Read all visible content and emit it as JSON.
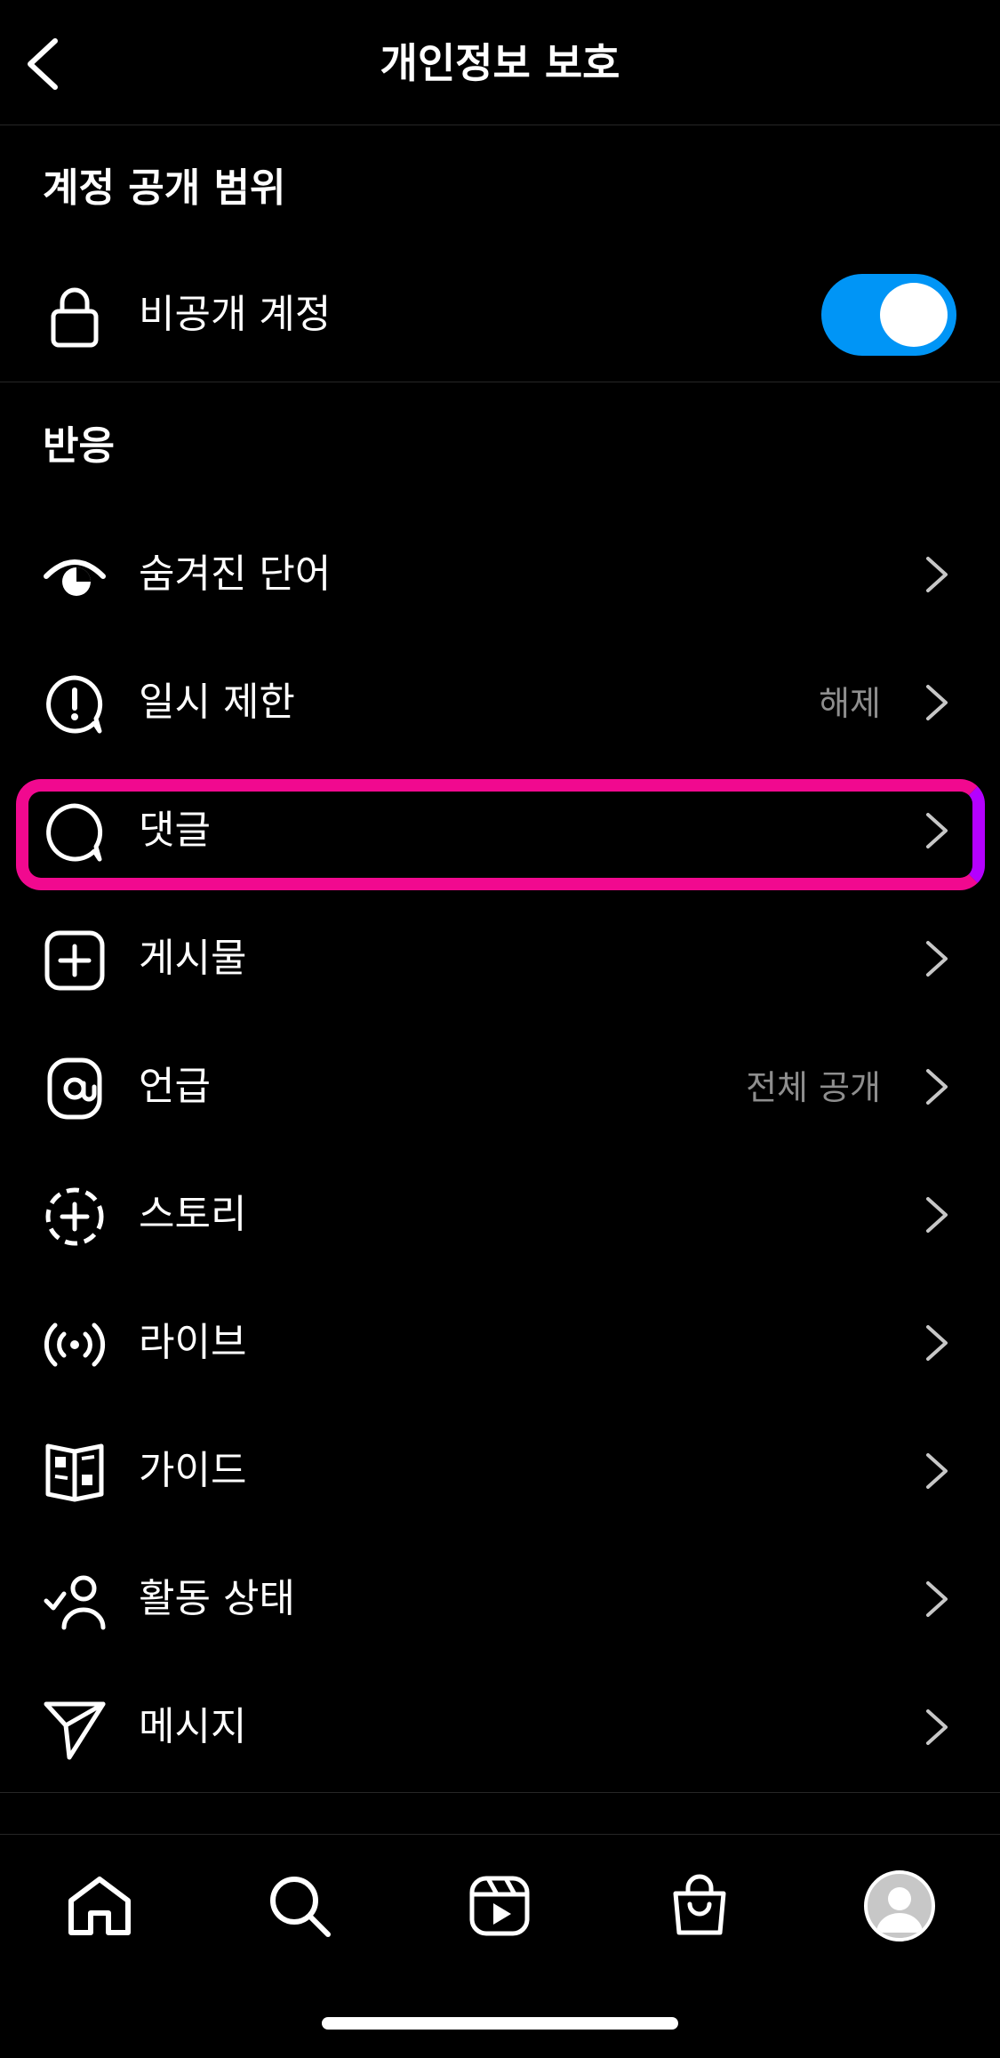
{
  "header": {
    "title": "개인정보 보호"
  },
  "sections": {
    "visibility": "계정 공개 범위",
    "interactions": "반응"
  },
  "private_account": {
    "label": "비공개 계정",
    "enabled": true,
    "icon": "lock-icon"
  },
  "items": [
    {
      "label": "숨겨진 단어",
      "value": "",
      "icon": "eye-hidden-icon"
    },
    {
      "label": "일시 제한",
      "value": "해제",
      "icon": "limit-alert-icon"
    },
    {
      "label": "댓글",
      "value": "",
      "icon": "comment-icon"
    },
    {
      "label": "게시물",
      "value": "",
      "icon": "add-post-icon"
    },
    {
      "label": "언급",
      "value": "전체 공개",
      "icon": "mention-icon"
    },
    {
      "label": "스토리",
      "value": "",
      "icon": "story-add-icon"
    },
    {
      "label": "라이브",
      "value": "",
      "icon": "live-icon"
    },
    {
      "label": "가이드",
      "value": "",
      "icon": "guide-icon"
    },
    {
      "label": "활동 상태",
      "value": "",
      "icon": "activity-status-icon"
    },
    {
      "label": "메시지",
      "value": "",
      "icon": "message-send-icon"
    }
  ],
  "tabbar": [
    "home-icon",
    "search-icon",
    "reels-icon",
    "shop-icon",
    "profile-avatar"
  ],
  "colors": {
    "toggle": "#0095f6",
    "highlight": "#f1098f",
    "muted": "#8e8e8e"
  }
}
